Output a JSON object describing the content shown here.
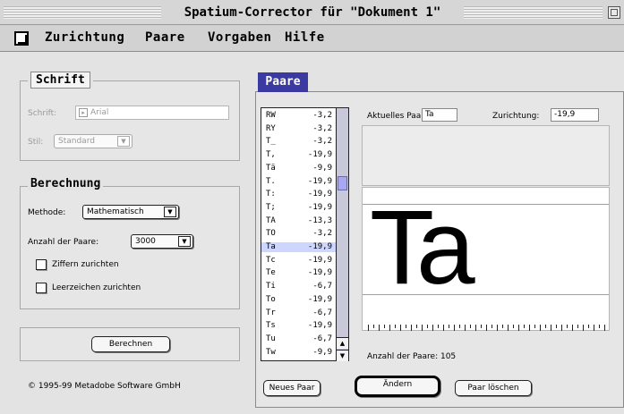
{
  "window": {
    "title": "Spatium-Corrector für \"Dokument 1\""
  },
  "menu": {
    "icon": "document-icon",
    "items": [
      "Zurichtung",
      "Paare",
      "Vorgaben",
      "Hilfe"
    ]
  },
  "schrift": {
    "title": "Schrift",
    "font_label": "Schrift:",
    "font_value": "Arial",
    "stil_label": "Stil:",
    "stil_value": "Standard"
  },
  "berechnung": {
    "title": "Berechnung",
    "methode_label": "Methode:",
    "methode_value": "Mathematisch",
    "anzahl_label": "Anzahl der Paare:",
    "anzahl_value": "3000",
    "checkbox_ziffern": "Ziffern zurichten",
    "checkbox_leerzeichen": "Leerzeichen zurichten",
    "berechnen_button": "Berechnen"
  },
  "copyright": "© 1995-99 Metadobe Software GmbH",
  "paare": {
    "tab_label": "Paare",
    "aktuelles_label": "Aktuelles Paar:",
    "aktuelles_value": "Ta",
    "zurichtung_label": "Zurichtung:",
    "zurichtung_value": "-19,9",
    "sample": "Ta",
    "count_label": "Anzahl der Paare: 105",
    "selected_index": 10,
    "list": [
      {
        "pair": "RW",
        "value": "-3,2"
      },
      {
        "pair": "RY",
        "value": "-3,2"
      },
      {
        "pair": "T_",
        "value": "-3,2"
      },
      {
        "pair": "T,",
        "value": "-19,9"
      },
      {
        "pair": "Tä",
        "value": "-9,9"
      },
      {
        "pair": "T.",
        "value": "-19,9"
      },
      {
        "pair": "T:",
        "value": "-19,9"
      },
      {
        "pair": "T;",
        "value": "-19,9"
      },
      {
        "pair": "TA",
        "value": "-13,3"
      },
      {
        "pair": "TO",
        "value": "-3,2"
      },
      {
        "pair": "Ta",
        "value": "-19,9"
      },
      {
        "pair": "Tc",
        "value": "-19,9"
      },
      {
        "pair": "Te",
        "value": "-19,9"
      },
      {
        "pair": "Ti",
        "value": "-6,7"
      },
      {
        "pair": "To",
        "value": "-19,9"
      },
      {
        "pair": "Tr",
        "value": "-6,7"
      },
      {
        "pair": "Ts",
        "value": "-19,9"
      },
      {
        "pair": "Tu",
        "value": "-6,7"
      },
      {
        "pair": "Tw",
        "value": "-9,9"
      }
    ],
    "buttons": {
      "neues": "Neues Paar",
      "aendern": "Ändern",
      "loeschen": "Paar löschen"
    }
  },
  "colors": {
    "tab_blue": "#3a3aa0",
    "selection": "#cdd6ff",
    "scroll_thumb": "#a8a8f0"
  }
}
